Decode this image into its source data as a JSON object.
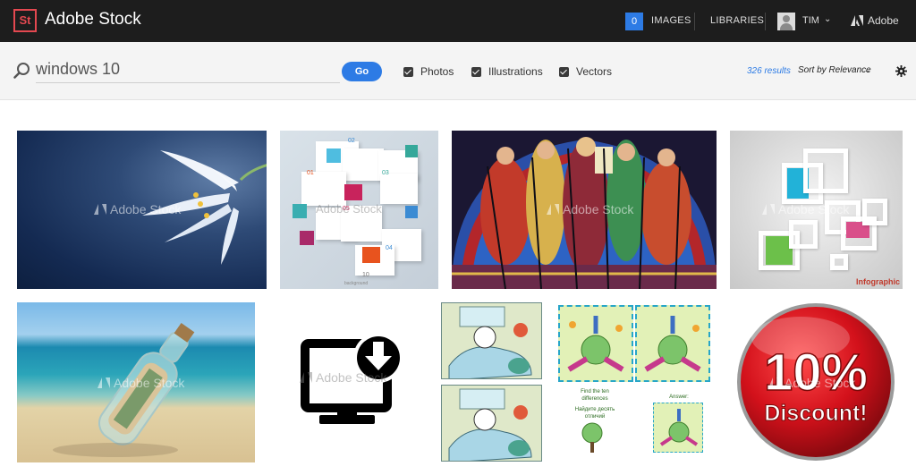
{
  "app": {
    "logo_text": "St",
    "title": "Adobe Stock"
  },
  "topnav": {
    "images_count": "0",
    "images_label": "IMAGES",
    "libraries_label": "LIBRARIES",
    "user_name": "TIM",
    "user_chevron": "⌄",
    "adobe_label": "Adobe"
  },
  "search": {
    "query": "windows 10",
    "go_label": "Go",
    "filters": [
      {
        "label": "Photos",
        "checked": true
      },
      {
        "label": "Illustrations",
        "checked": true
      },
      {
        "label": "Vectors",
        "checked": true
      }
    ],
    "results_count": "326 results",
    "sort_label": "Sort by Relevance",
    "sort_chevron": "⌄"
  },
  "results": {
    "watermark": "Adobe Stock",
    "tiles": [
      {
        "name": "lily-flower-photo"
      },
      {
        "name": "infographic-squares-illustration",
        "numbers": [
          "01",
          "02",
          "03",
          "04",
          "05",
          "10"
        ],
        "caption": "background"
      },
      {
        "name": "stained-glass-photo"
      },
      {
        "name": "grey-squares-infographic",
        "caption": "Infographic"
      },
      {
        "name": "message-bottle-photo"
      },
      {
        "name": "monitor-download-icon"
      },
      {
        "name": "cartoon-sick-character-comic"
      },
      {
        "name": "find-differences-puzzle",
        "caption_en": "Find the ten differences",
        "caption_ru": "Найдите десять отличий",
        "answer_label": "Answer:"
      },
      {
        "name": "discount-badge",
        "headline": "10%",
        "subline": "Discount!"
      }
    ]
  },
  "colors": {
    "topbar": "#1d1d1d",
    "accent_blue": "#2d7be5",
    "logo_red": "#e34850",
    "discount_red": "#d3111b"
  }
}
